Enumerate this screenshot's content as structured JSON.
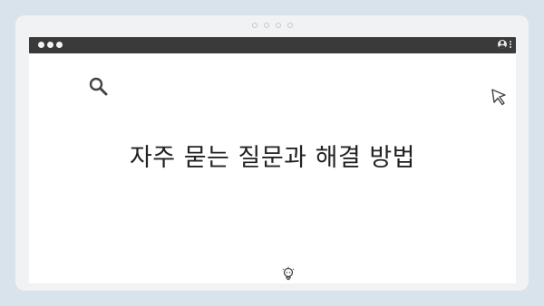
{
  "page": {
    "title": "자주 묻는 질문과 해결 방법"
  },
  "icons": {
    "search": "search-icon",
    "cursor": "cursor-pointer-icon",
    "user": "user-account-icon",
    "menu": "kebab-menu-icon",
    "bulb": "lightbulb-icon"
  },
  "colors": {
    "background": "#d9e3eb",
    "frame": "#f1f2f4",
    "browser_bar": "#3a3a3a",
    "content": "#ffffff",
    "text": "#222222"
  }
}
